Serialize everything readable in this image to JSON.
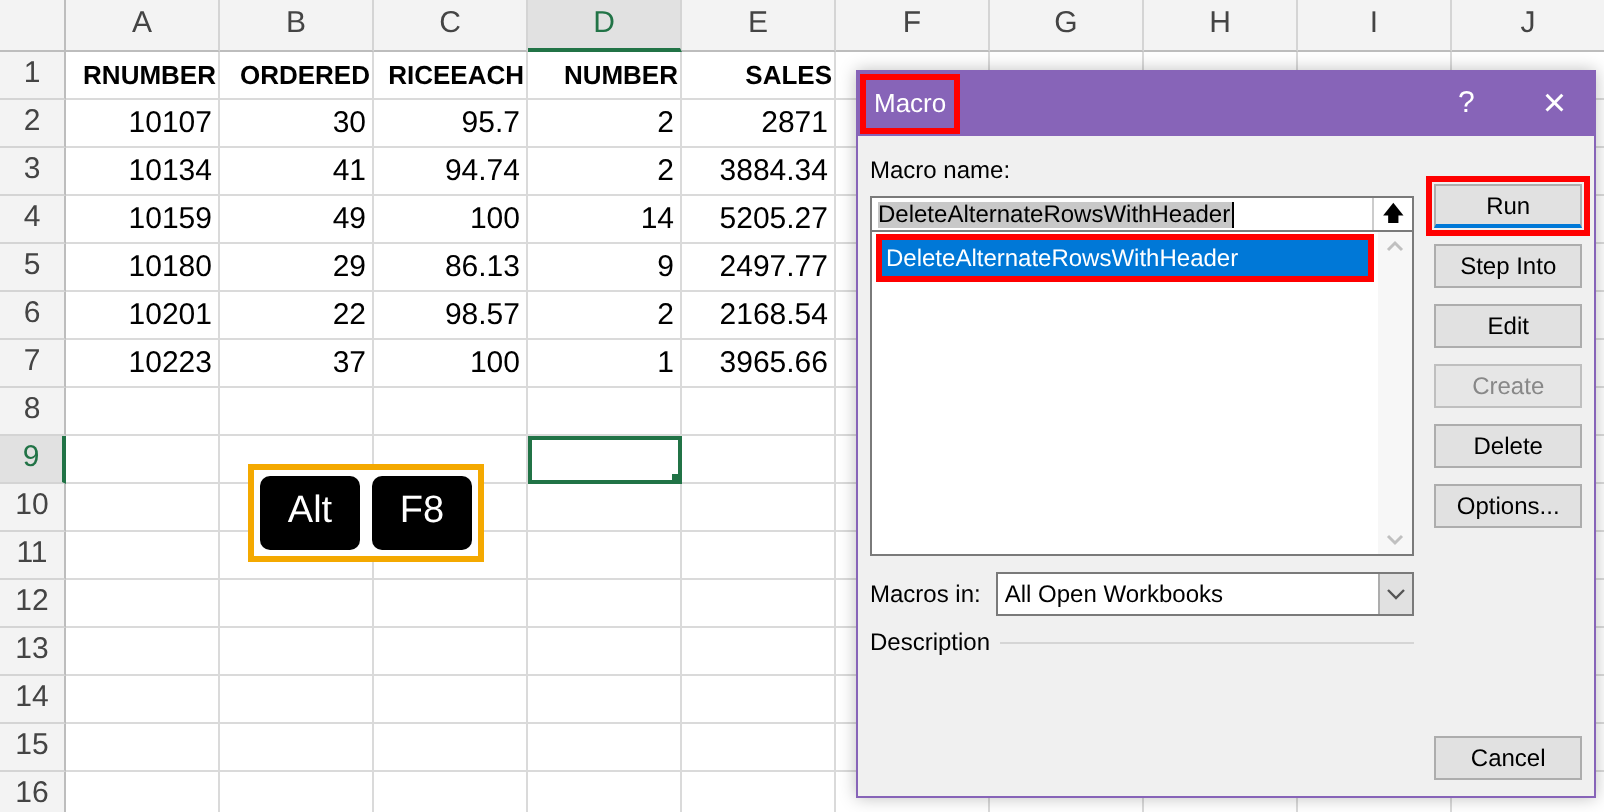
{
  "sheet": {
    "columns": [
      {
        "label": "A",
        "selected": false
      },
      {
        "label": "B",
        "selected": false
      },
      {
        "label": "C",
        "selected": false
      },
      {
        "label": "D",
        "selected": true
      },
      {
        "label": "E",
        "selected": false
      },
      {
        "label": "F",
        "selected": false
      },
      {
        "label": "G",
        "selected": false
      },
      {
        "label": "H",
        "selected": false
      },
      {
        "label": "I",
        "selected": false
      },
      {
        "label": "J",
        "selected": false
      }
    ],
    "rows": [
      {
        "label": "1",
        "selected": false,
        "kind": "header",
        "cells": [
          "RNUMBER",
          "ORDERED",
          "RICEEACH",
          "NUMBER",
          "SALES"
        ]
      },
      {
        "label": "2",
        "selected": false,
        "kind": "data",
        "cells": [
          "10107",
          "30",
          "95.7",
          "2",
          "2871"
        ]
      },
      {
        "label": "3",
        "selected": false,
        "kind": "data",
        "cells": [
          "10134",
          "41",
          "94.74",
          "2",
          "3884.34"
        ]
      },
      {
        "label": "4",
        "selected": false,
        "kind": "data",
        "cells": [
          "10159",
          "49",
          "100",
          "14",
          "5205.27"
        ]
      },
      {
        "label": "5",
        "selected": false,
        "kind": "data",
        "cells": [
          "10180",
          "29",
          "86.13",
          "9",
          "2497.77"
        ]
      },
      {
        "label": "6",
        "selected": false,
        "kind": "data",
        "cells": [
          "10201",
          "22",
          "98.57",
          "2",
          "2168.54"
        ]
      },
      {
        "label": "7",
        "selected": false,
        "kind": "data",
        "cells": [
          "10223",
          "37",
          "100",
          "1",
          "3965.66"
        ]
      },
      {
        "label": "8",
        "selected": false
      },
      {
        "label": "9",
        "selected": true
      },
      {
        "label": "10",
        "selected": false
      },
      {
        "label": "11",
        "selected": false
      },
      {
        "label": "12",
        "selected": false
      },
      {
        "label": "13",
        "selected": false
      },
      {
        "label": "14",
        "selected": false
      },
      {
        "label": "15",
        "selected": false
      },
      {
        "label": "16",
        "selected": false
      }
    ]
  },
  "shortcut_keys": [
    "Alt",
    "F8"
  ],
  "dialog": {
    "title": "Macro",
    "title_highlighted": true,
    "help": "?",
    "close": "×",
    "macro_name_label": "Macro name:",
    "macro_name_value": "DeleteAlternateRowsWithHeader",
    "up_button": "🡅",
    "macros": [
      {
        "label": "DeleteAlternateRowsWithHeader",
        "selected": true,
        "highlighted": true
      }
    ],
    "buttons": [
      {
        "label": "Run",
        "default": true,
        "disabled": false,
        "highlighted": true
      },
      {
        "label": "Step Into",
        "default": false,
        "disabled": false,
        "highlighted": false
      },
      {
        "label": "Edit",
        "default": false,
        "disabled": false,
        "highlighted": false
      },
      {
        "label": "Create",
        "default": false,
        "disabled": true,
        "highlighted": false
      },
      {
        "label": "Delete",
        "default": false,
        "disabled": false,
        "highlighted": false
      },
      {
        "label": "Options...",
        "default": false,
        "disabled": false,
        "highlighted": false
      }
    ],
    "macros_in_label": "Macros in:",
    "macros_in_value": "All Open Workbooks",
    "description_label": "Description",
    "cancel": "Cancel"
  }
}
